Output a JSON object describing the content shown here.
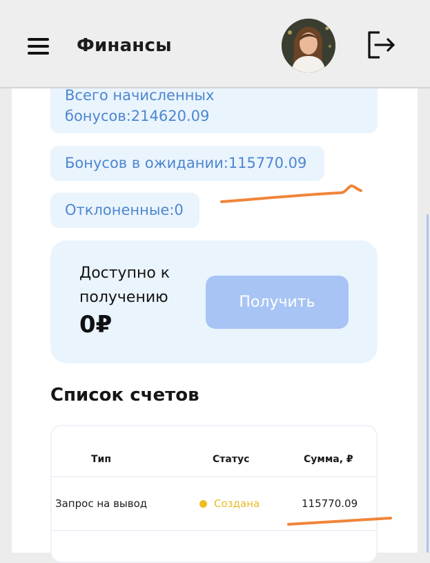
{
  "header": {
    "title": "Финансы",
    "menu_icon": "hamburger-menu-icon",
    "logout_icon": "logout-icon"
  },
  "bonuses": {
    "total_label": "Всего начисленных бонусов:214620.09",
    "pending_label": "Бонусов в ожидании:115770.09",
    "rejected_label": "Отклоненные:0"
  },
  "available": {
    "label": "Доступно к получению",
    "amount": "0₽",
    "button_label": "Получить"
  },
  "invoices": {
    "title": "Список счетов",
    "columns": [
      "Тип",
      "Статус",
      "Сумма, ₽"
    ],
    "rows": [
      {
        "type": "Запрос на вывод",
        "status": "Создана",
        "amount": "115770.09"
      }
    ]
  },
  "colors": {
    "accent_text": "#4d86d0",
    "chip_background": "#eaf4fd",
    "button_background": "#a7c4f5",
    "status_created": "#f0bc22",
    "annotation_stroke": "#f0853a"
  }
}
